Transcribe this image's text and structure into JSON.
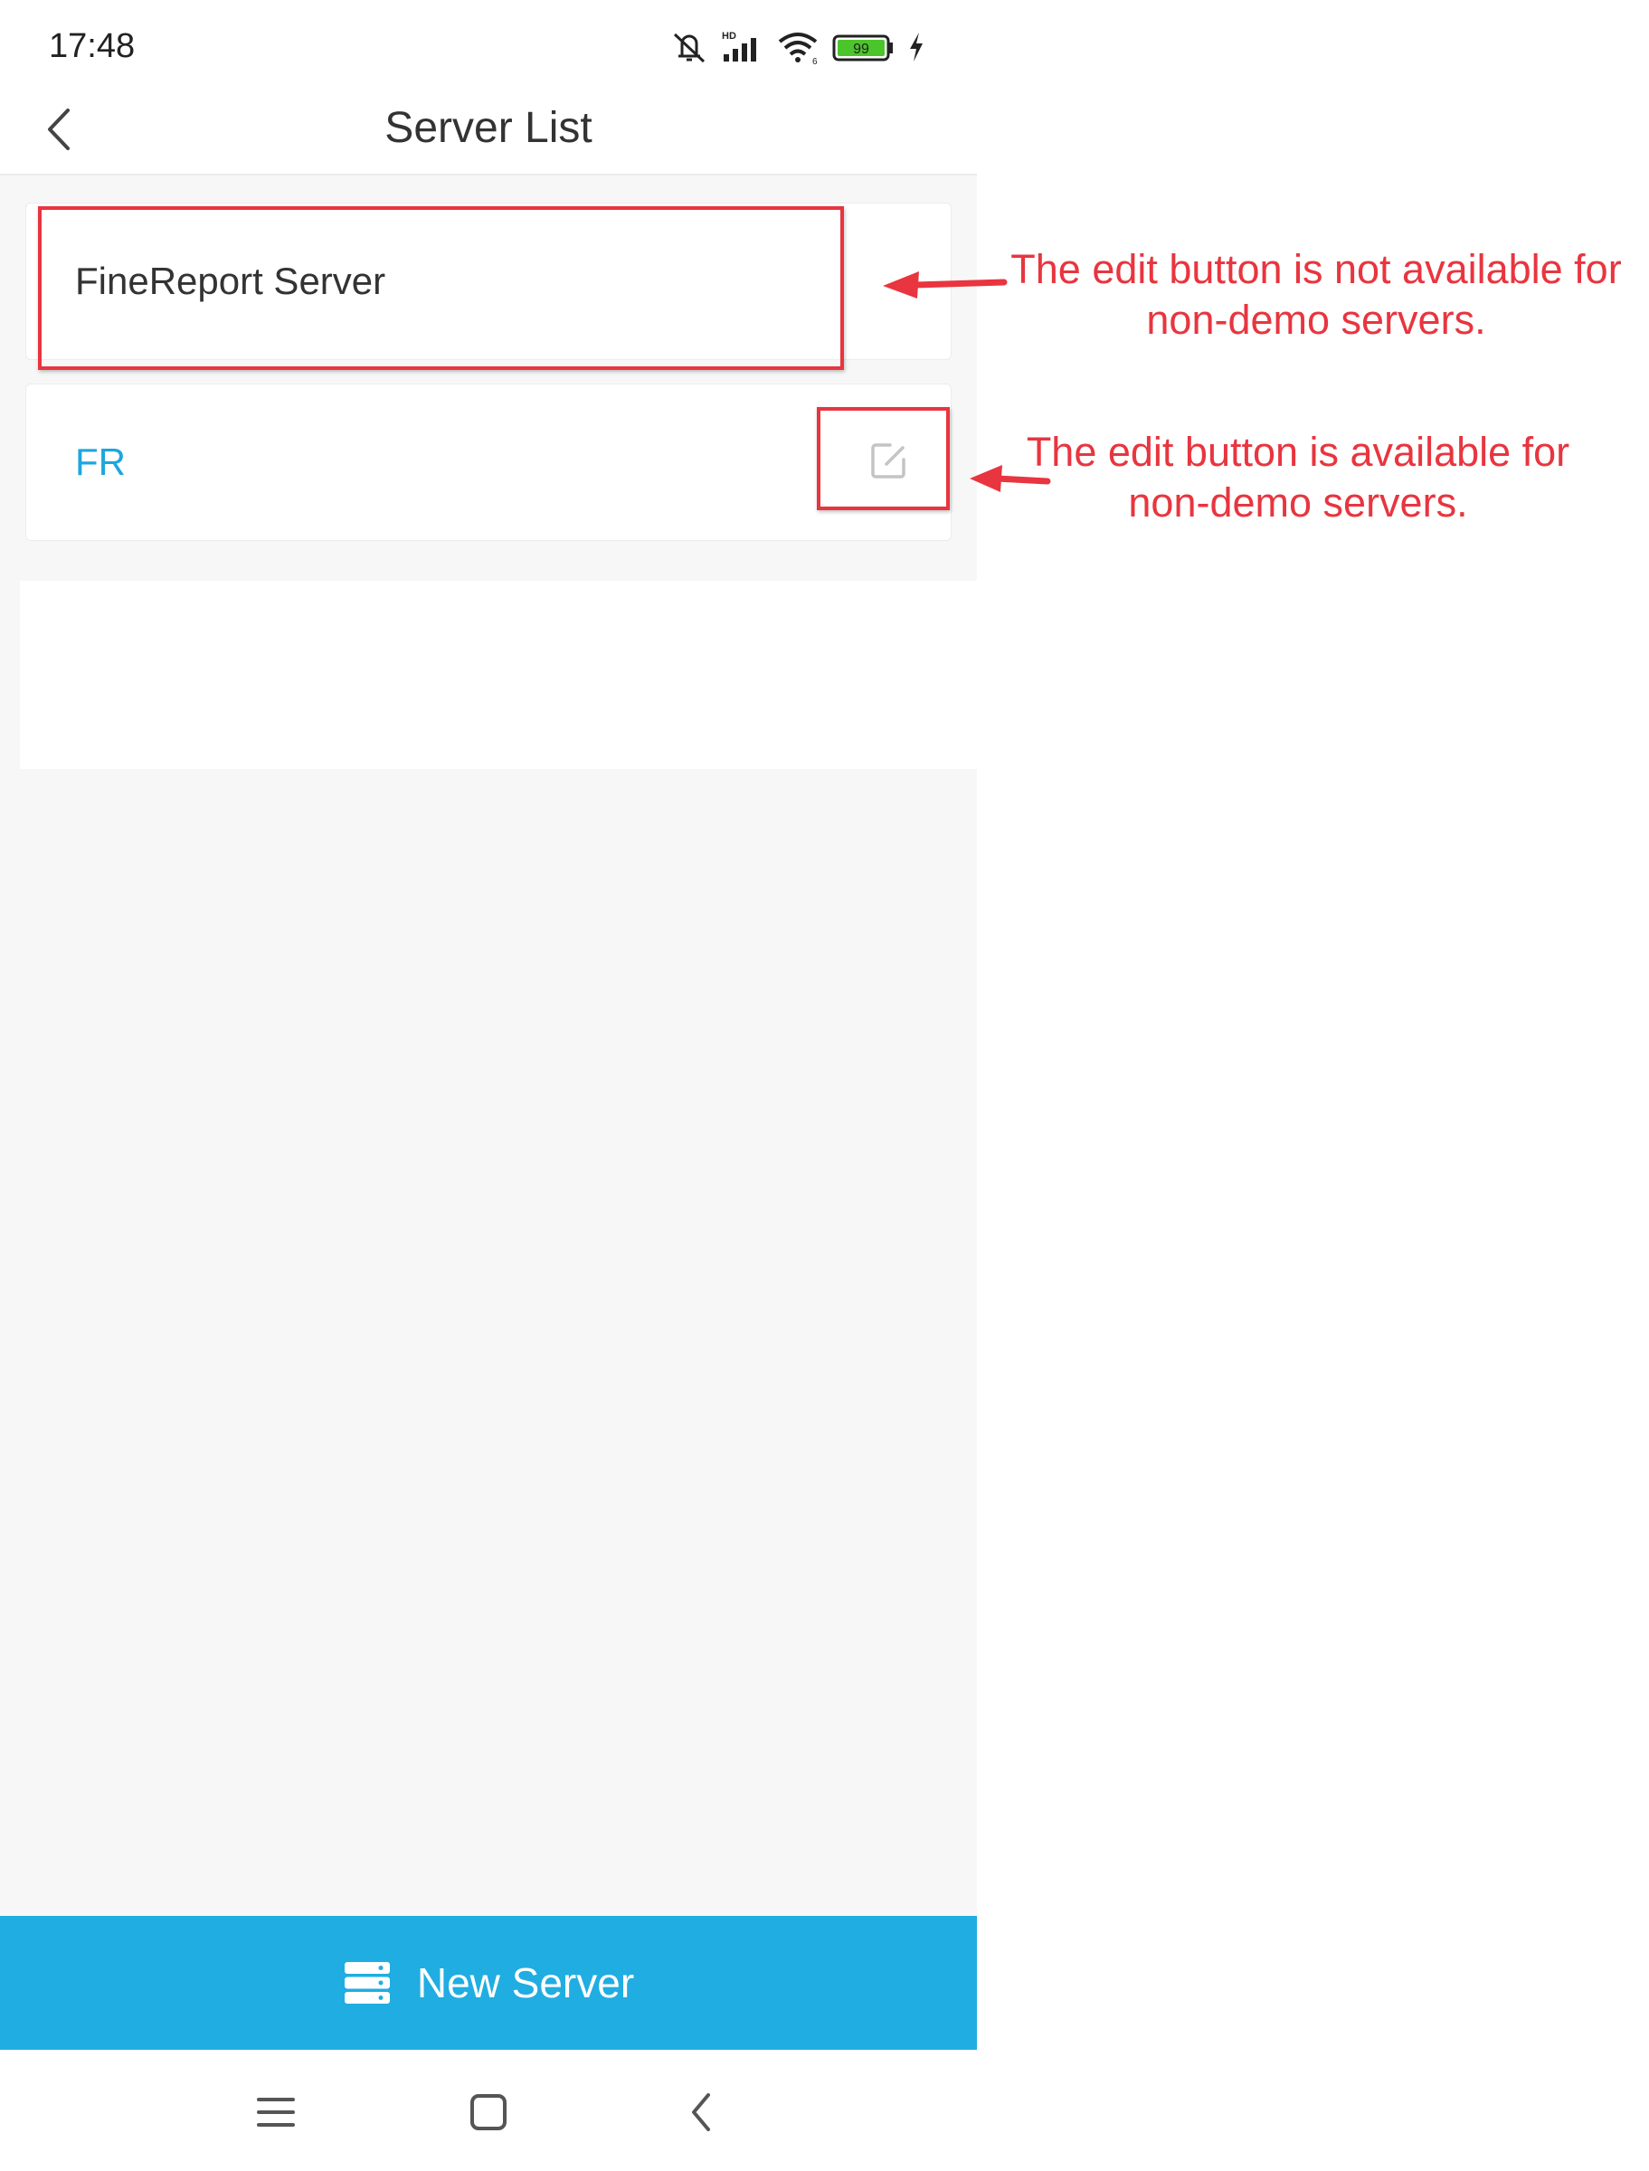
{
  "status_bar": {
    "time": "17:48",
    "icons": [
      "mute-icon",
      "hd-signal-icon",
      "wifi-icon",
      "battery-icon",
      "charging-icon"
    ],
    "network_badge": "HD",
    "wifi_badge": "6",
    "battery_level": "99"
  },
  "header": {
    "title": "Server List",
    "back_icon": "chevron-left-icon"
  },
  "servers": [
    {
      "name": "FineReport Server",
      "editable": false
    },
    {
      "name": "FR",
      "editable": true,
      "edit_icon": "edit-icon"
    }
  ],
  "footer": {
    "new_server_label": "New Server",
    "new_server_icon": "server-stack-icon"
  },
  "nav_bar": {
    "icons": [
      "menu-icon",
      "home-icon",
      "back-icon"
    ]
  },
  "annotations": [
    {
      "text": "The edit button is not available for non-demo servers."
    },
    {
      "text": "The edit button is available for non-demo servers."
    }
  ],
  "colors": {
    "accent": "#20ade2",
    "link": "#1ea6dd",
    "annotation": "#e8353f",
    "battery": "#4cc52c"
  }
}
